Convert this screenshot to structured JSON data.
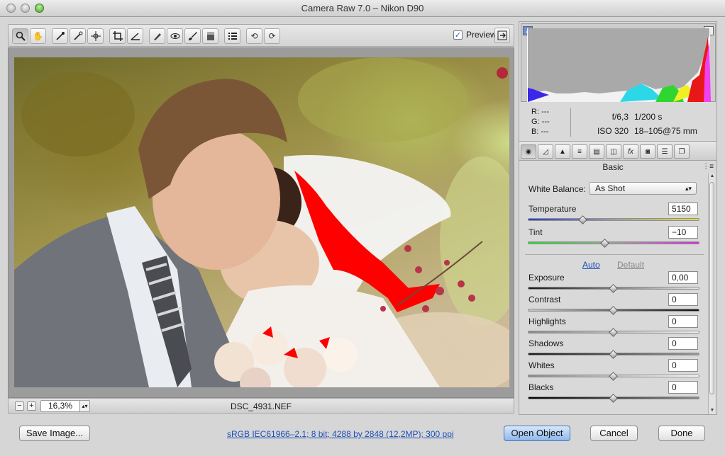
{
  "window": {
    "title": "Camera Raw 7.0  –  Nikon D90"
  },
  "toolbar": {
    "tools": [
      "zoom-tool",
      "hand-tool",
      "white-balance-tool",
      "color-sampler-tool",
      "targeted-adjustment-tool",
      "crop-tool",
      "straighten-tool",
      "spot-removal-tool",
      "red-eye-tool",
      "adjustment-brush-tool",
      "graduated-filter-tool",
      "preferences",
      "rotate-left",
      "rotate-right"
    ],
    "preview_label": "Preview",
    "preview_checked": true
  },
  "image": {
    "filename": "DSC_4931.NEF",
    "zoom": "16,3%"
  },
  "info": {
    "r_label": "R:",
    "r_value": "---",
    "g_label": "G:",
    "g_value": "---",
    "b_label": "B:",
    "b_value": "---",
    "aperture": "f/6,3",
    "shutter": "1/200 s",
    "iso": "ISO 320",
    "lens": "18–105@75 mm"
  },
  "panel": {
    "title": "Basic",
    "white_balance_label": "White Balance:",
    "white_balance_value": "As Shot",
    "temperature_label": "Temperature",
    "temperature_value": "5150",
    "tint_label": "Tint",
    "tint_value": "−10",
    "auto_label": "Auto",
    "default_label": "Default",
    "sliders": [
      {
        "label": "Exposure",
        "value": "0,00"
      },
      {
        "label": "Contrast",
        "value": "0"
      },
      {
        "label": "Highlights",
        "value": "0"
      },
      {
        "label": "Shadows",
        "value": "0"
      },
      {
        "label": "Whites",
        "value": "0"
      },
      {
        "label": "Blacks",
        "value": "0"
      }
    ]
  },
  "bottom": {
    "save_label": "Save Image...",
    "workflow_label": "sRGB IEC61966–2.1; 8 bit; 4288 by 2848 (12,2MP); 300 ppi",
    "open_label": "Open Object",
    "cancel_label": "Cancel",
    "done_label": "Done"
  }
}
